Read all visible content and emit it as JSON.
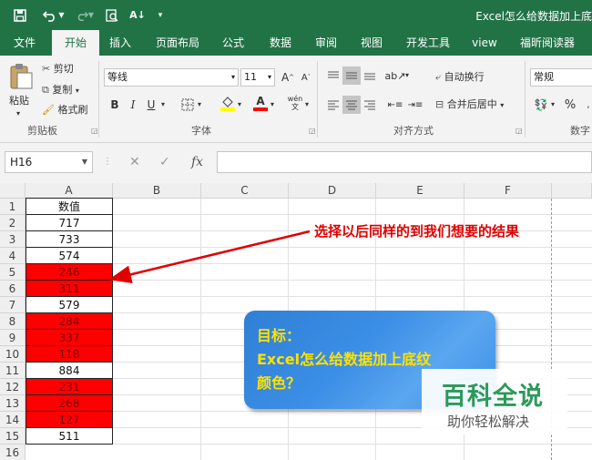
{
  "window": {
    "title": "Excel怎么给数据加上底",
    "qat": [
      "save-icon",
      "undo-icon",
      "redo-icon",
      "print-preview-icon",
      "sort-ascending-icon",
      "customize-qat-icon"
    ]
  },
  "tabs": [
    "文件",
    "开始",
    "插入",
    "页面布局",
    "公式",
    "数据",
    "审阅",
    "视图",
    "开发工具",
    "view",
    "福昕阅读器"
  ],
  "active_tab": "开始",
  "ribbon": {
    "clipboard": {
      "paste": "粘贴",
      "cut": "剪切",
      "copy": "复制",
      "format_painter": "格式刷",
      "label": "剪贴板"
    },
    "font": {
      "name": "等线",
      "size": "11",
      "bold": "B",
      "italic": "I",
      "underline": "U",
      "grow": "A",
      "shrink": "A",
      "font_color": "A",
      "phonetic": "wén",
      "label": "字体"
    },
    "alignment": {
      "wrap": "自动换行",
      "merge": "合并后居中",
      "label": "对齐方式"
    },
    "number": {
      "format": "常规",
      "percent": "%",
      "label": "数字"
    }
  },
  "formula_bar": {
    "name_box": "H16",
    "cancel": "✕",
    "enter": "✓",
    "fx": "fx",
    "content": ""
  },
  "sheet": {
    "columns": [
      "A",
      "B",
      "C",
      "D",
      "E",
      "F"
    ],
    "rows": [
      "1",
      "2",
      "3",
      "4",
      "5",
      "6",
      "7",
      "8",
      "9",
      "10",
      "11",
      "12",
      "13",
      "14",
      "15",
      "16"
    ],
    "column_a": [
      {
        "value": "数值",
        "highlight": false
      },
      {
        "value": "717",
        "highlight": false
      },
      {
        "value": "733",
        "highlight": false
      },
      {
        "value": "574",
        "highlight": false
      },
      {
        "value": "246",
        "highlight": true
      },
      {
        "value": "311",
        "highlight": true
      },
      {
        "value": "579",
        "highlight": false
      },
      {
        "value": "284",
        "highlight": true
      },
      {
        "value": "337",
        "highlight": true
      },
      {
        "value": "118",
        "highlight": true
      },
      {
        "value": "884",
        "highlight": false
      },
      {
        "value": "231",
        "highlight": true
      },
      {
        "value": "268",
        "highlight": true
      },
      {
        "value": "127",
        "highlight": true
      },
      {
        "value": "511",
        "highlight": false
      }
    ],
    "highlight_color": "#ff0000"
  },
  "annotation": "选择以后同样的到我们想要的结果",
  "callout": {
    "line1": "目标：",
    "line2": "Excel怎么给数据加上底纹",
    "line3": "颜色？"
  },
  "watermark": {
    "title": "百科全说",
    "subtitle": "助你轻松解决"
  },
  "colors": {
    "excel_green": "#217346",
    "annotation_red": "#e00000",
    "callout_text": "#ffe100",
    "watermark_green": "#2c9a5a"
  }
}
